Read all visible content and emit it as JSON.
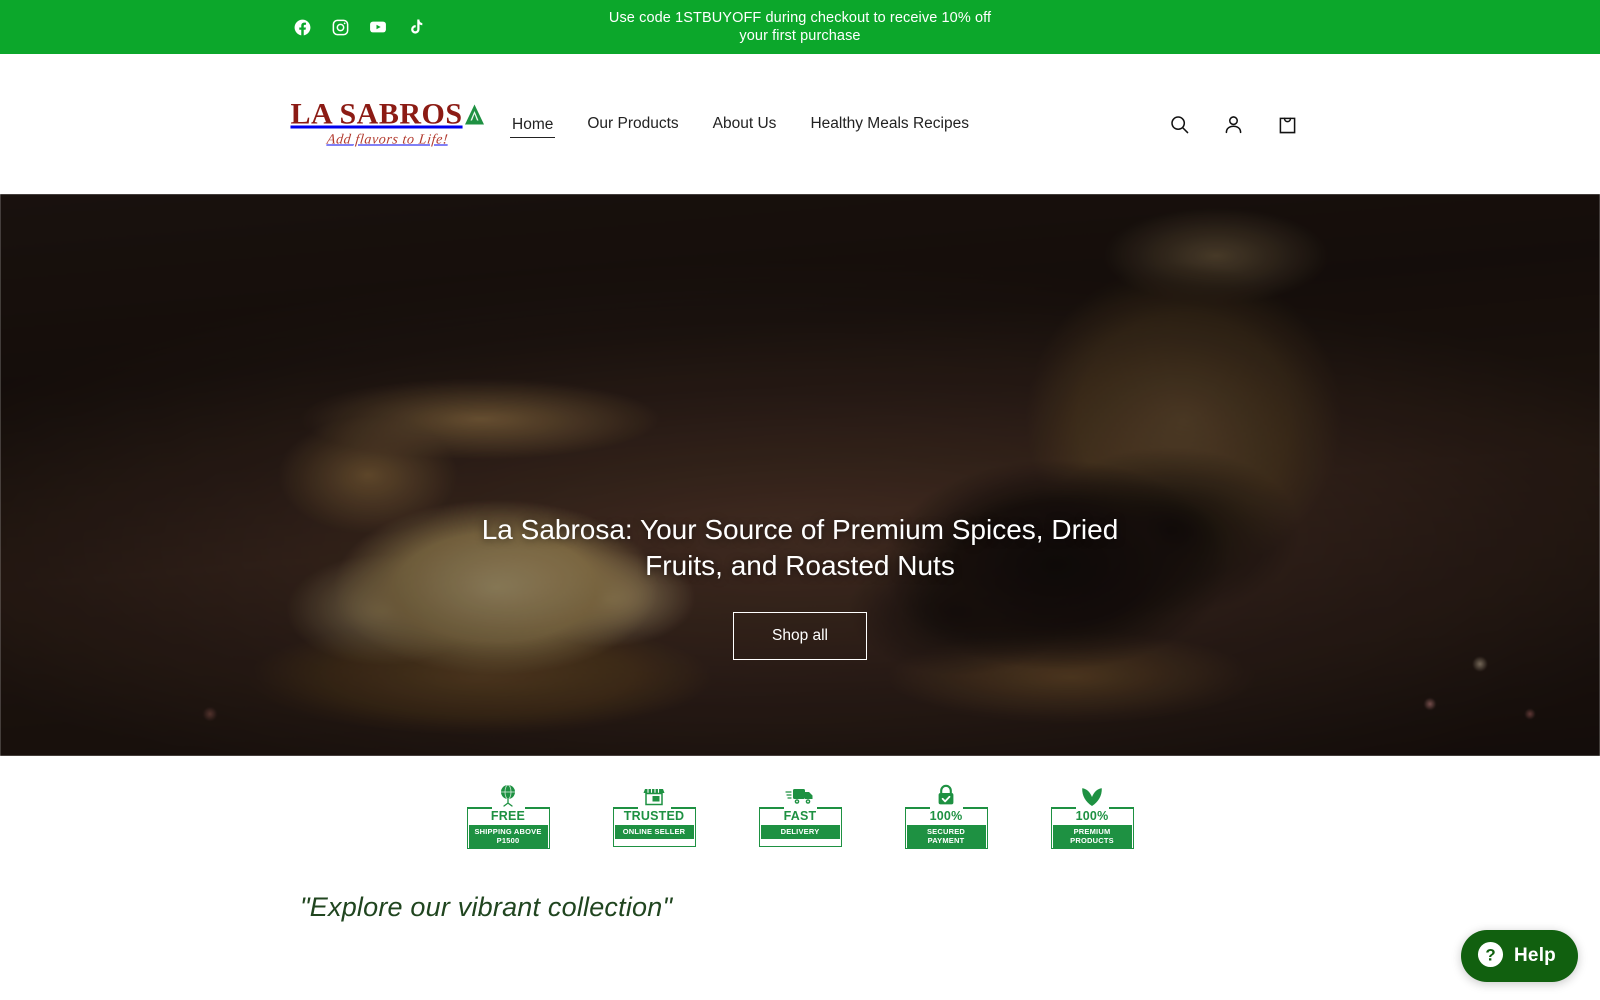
{
  "announcement": {
    "text": "Use code 1STBUYOFF during checkout to receive 10% off your first purchase",
    "background_color": "#0CA72B",
    "social_links": [
      {
        "name": "facebook-icon",
        "label": "Facebook"
      },
      {
        "name": "instagram-icon",
        "label": "Instagram"
      },
      {
        "name": "youtube-icon",
        "label": "YouTube"
      },
      {
        "name": "tiktok-icon",
        "label": "TikTok"
      }
    ]
  },
  "header": {
    "logo": {
      "wordmark": "LA SABROS",
      "wordmark_accent": "A",
      "tagline": "Add flavors to Life!",
      "wordmark_color": "#8C1B14",
      "accent_color": "#1E9142",
      "tagline_color": "#B23A2E"
    },
    "nav": [
      {
        "label": "Home",
        "active": true
      },
      {
        "label": "Our Products",
        "active": false
      },
      {
        "label": "About Us",
        "active": false
      },
      {
        "label": "Healthy Meals Recipes",
        "active": false
      }
    ],
    "actions": [
      {
        "name": "search-icon",
        "label": "Search"
      },
      {
        "name": "account-icon",
        "label": "Log in"
      },
      {
        "name": "cart-icon",
        "label": "Cart"
      }
    ]
  },
  "hero": {
    "heading": "La Sabrosa: Your Source of Premium Spices, Dried Fruits, and Roasted Nuts",
    "cta_label": "Shop all"
  },
  "trust_badges": [
    {
      "icon": "globe-icon",
      "title": "FREE",
      "subtitle": "SHIPPING ABOVE P1500"
    },
    {
      "icon": "store-icon",
      "title": "TRUSTED",
      "subtitle": "ONLINE SELLER"
    },
    {
      "icon": "truck-icon",
      "title": "FAST",
      "subtitle": "DELIVERY"
    },
    {
      "icon": "lock-icon",
      "title": "100%",
      "subtitle": "SECURED PAYMENT"
    },
    {
      "icon": "leaf-icon",
      "title": "100%",
      "subtitle": "PREMIUM PRODUCTS"
    }
  ],
  "collection": {
    "quote": "\"Explore our vibrant collection\""
  },
  "help_widget": {
    "label": "Help",
    "background_color": "#11600F"
  }
}
